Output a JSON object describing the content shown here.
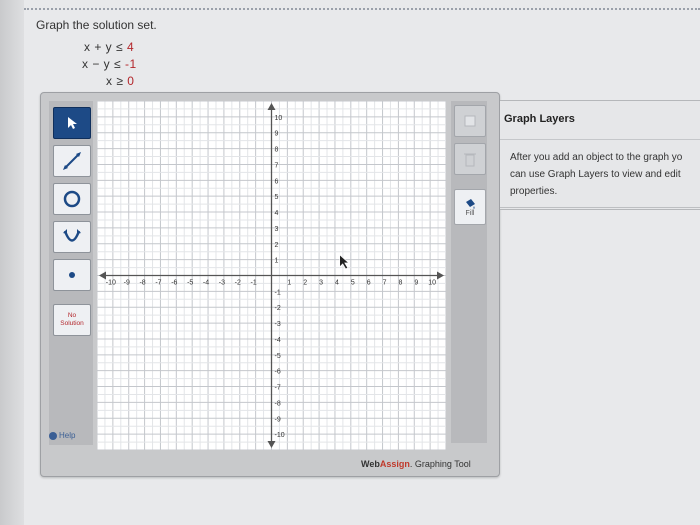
{
  "question": {
    "title": "Graph the solution set.",
    "inequalities": [
      {
        "lhs": "x + y ≤",
        "rhs": "4"
      },
      {
        "lhs": "x − y ≤",
        "rhs": "-1"
      },
      {
        "lhs": "x ≥",
        "rhs": "0"
      }
    ]
  },
  "tools": [
    {
      "name": "pointer-tool-icon",
      "active": true
    },
    {
      "name": "line-tool-icon",
      "active": false
    },
    {
      "name": "circle-tool-icon",
      "active": false
    },
    {
      "name": "parabola-tool-icon",
      "active": false
    },
    {
      "name": "point-tool-icon",
      "active": false
    }
  ],
  "no_solution": {
    "line1": "No",
    "line2": "Solution"
  },
  "help_label": "Help",
  "right_tools": {
    "fill_label": "Fill"
  },
  "graph": {
    "x_range": [
      -11,
      11
    ],
    "y_range": [
      -11,
      11
    ],
    "x_ticks": [
      "-10",
      "-9",
      "-8",
      "-7",
      "-6",
      "-5",
      "-4",
      "-3",
      "-2",
      "-1",
      "1",
      "2",
      "3",
      "4",
      "5",
      "6",
      "7",
      "8",
      "9",
      "10"
    ],
    "y_ticks": [
      "10",
      "9",
      "8",
      "7",
      "6",
      "5",
      "4",
      "3",
      "2",
      "1",
      "-1",
      "-2",
      "-3",
      "-4",
      "-5",
      "-6",
      "-7",
      "-8",
      "-9",
      "-10"
    ],
    "grid": true
  },
  "brand": {
    "web": "Web",
    "assign": "Assign",
    "suffix": ". Graphing Tool"
  },
  "layers": {
    "title": "Graph Layers",
    "text_lines": [
      "After you add an object to the graph yo",
      "can use Graph Layers to view and edit",
      "properties."
    ]
  }
}
